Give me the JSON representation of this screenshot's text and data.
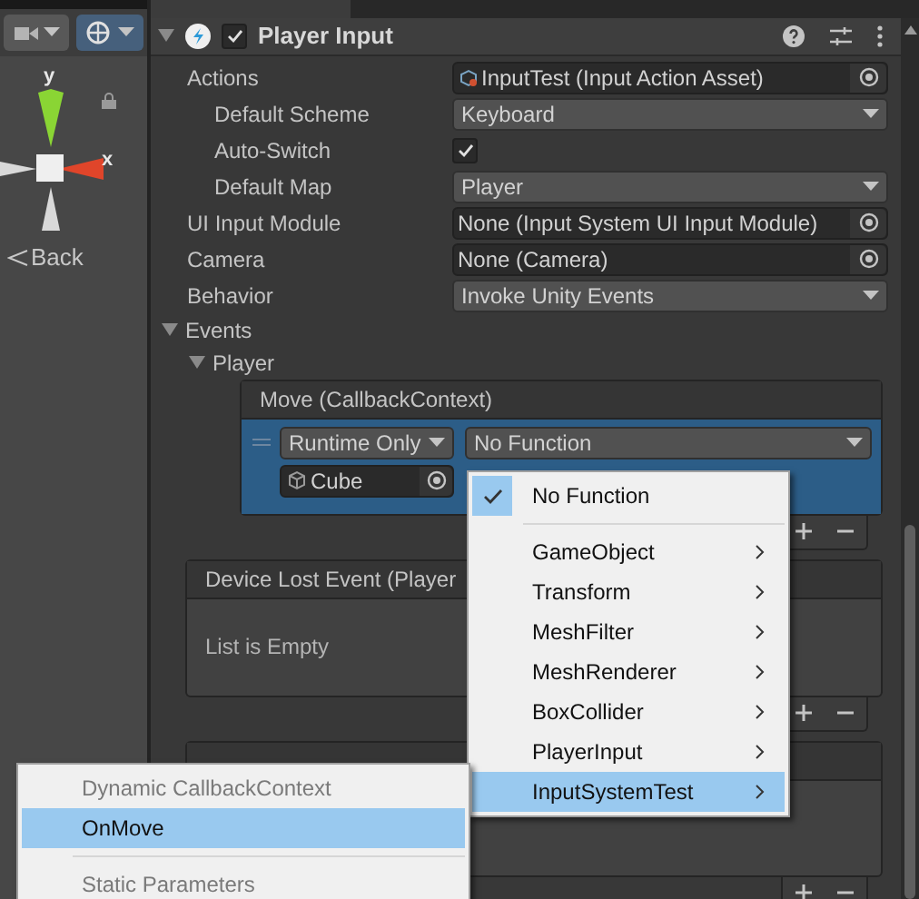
{
  "scene": {
    "axis_labels": [
      "y",
      "x"
    ],
    "back_label": "Back"
  },
  "component": {
    "title": "Player Input",
    "enabled": true,
    "expanded": true
  },
  "properties": [
    {
      "kind": "object",
      "label": "Actions",
      "value": "InputTest (Input Action Asset)",
      "children": [
        {
          "kind": "dropdown",
          "label": "Default Scheme",
          "value": "Keyboard"
        },
        {
          "kind": "checkbox",
          "label": "Auto-Switch",
          "checked": true
        },
        {
          "kind": "dropdown",
          "label": "Default Map",
          "value": "Player"
        }
      ]
    },
    {
      "kind": "object",
      "label": "UI Input Module",
      "value": "None (Input System UI Input Module)"
    },
    {
      "kind": "object",
      "label": "Camera",
      "value": "None (Camera)"
    },
    {
      "kind": "dropdown",
      "label": "Behavior",
      "value": "Invoke Unity Events"
    }
  ],
  "events": {
    "label": "Events",
    "expanded": true,
    "group": {
      "label": "Player",
      "expanded": true
    }
  },
  "event_boxes": [
    {
      "title": "Move (CallbackContext)",
      "listeners": [
        {
          "mode": "Runtime Only",
          "function": "No Function",
          "target": "Cube",
          "selected": true
        }
      ]
    },
    {
      "title": "Device Lost Event (Player",
      "empty_text": "List is Empty"
    },
    {
      "kind": "covered"
    }
  ],
  "function_menu": {
    "items": [
      {
        "kind": "item",
        "label": "No Function",
        "checked": true,
        "selected": false
      },
      {
        "kind": "separator"
      },
      {
        "kind": "submenu",
        "label": "GameObject",
        "checked": false,
        "selected": false
      },
      {
        "kind": "submenu",
        "label": "Transform",
        "checked": false,
        "selected": false
      },
      {
        "kind": "submenu",
        "label": "MeshFilter",
        "checked": false,
        "selected": false
      },
      {
        "kind": "submenu",
        "label": "MeshRenderer",
        "checked": false,
        "selected": false
      },
      {
        "kind": "submenu",
        "label": "BoxCollider",
        "checked": false,
        "selected": false
      },
      {
        "kind": "submenu",
        "label": "PlayerInput",
        "checked": false,
        "selected": false
      },
      {
        "kind": "submenu",
        "label": "InputSystemTest",
        "checked": false,
        "selected": true
      }
    ]
  },
  "method_menu": {
    "items": [
      {
        "kind": "header",
        "label": "Dynamic CallbackContext"
      },
      {
        "kind": "item",
        "label": "OnMove",
        "selected": true
      },
      {
        "kind": "separator"
      },
      {
        "kind": "header",
        "label": "Static Parameters"
      }
    ]
  }
}
